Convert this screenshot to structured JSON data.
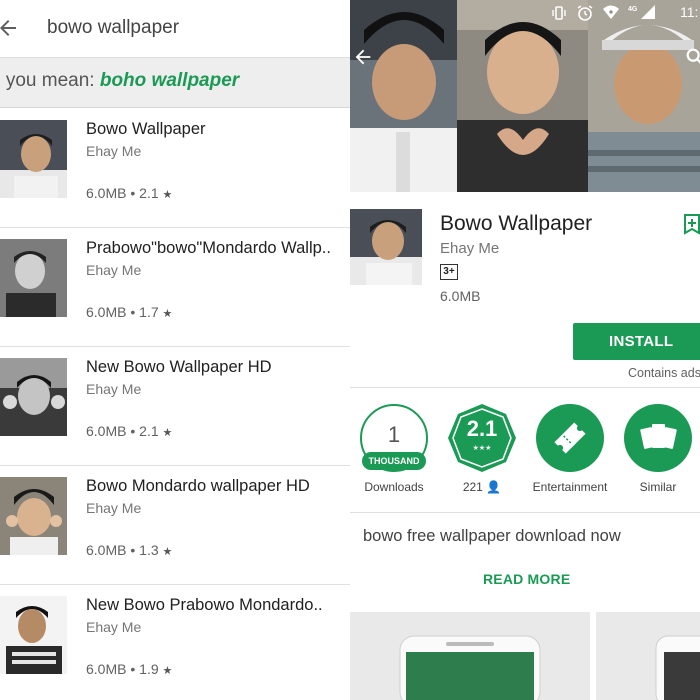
{
  "search": {
    "query": "bowo wallpaper",
    "did_you_mean_prefix": "d you mean: ",
    "did_you_mean_suggestion": "boho wallpaper"
  },
  "results": [
    {
      "title": "Bowo Wallpaper",
      "developer": "Ehay Me",
      "size": "6.0MB",
      "rating": "2.1"
    },
    {
      "title": "Prabowo\"bowo\"Mondardo Wallp..",
      "developer": "Ehay Me",
      "size": "6.0MB",
      "rating": "1.7"
    },
    {
      "title": "New Bowo Wallpaper HD",
      "developer": "Ehay Me",
      "size": "6.0MB",
      "rating": "2.1"
    },
    {
      "title": "Bowo Mondardo wallpaper HD",
      "developer": "Ehay Me",
      "size": "6.0MB",
      "rating": "1.3"
    },
    {
      "title": "New Bowo Prabowo Mondardo..",
      "developer": "Ehay Me",
      "size": "6.0MB",
      "rating": "1.9"
    }
  ],
  "status_bar": {
    "network": "4G",
    "time": "11:"
  },
  "app": {
    "title": "Bowo Wallpaper",
    "developer": "Ehay Me",
    "content_rating": "3+",
    "size": "6.0MB",
    "install_label": "INSTALL",
    "contains_ads": "Contains ads"
  },
  "stats": {
    "downloads_number": "1",
    "downloads_badge": "THOUSAND",
    "downloads_label": "Downloads",
    "rating_value": "2.1",
    "rating_count": "221",
    "category_label": "Entertainment",
    "similar_label": "Similar"
  },
  "description": {
    "text": "bowo free wallpaper download now",
    "read_more": "READ MORE"
  },
  "colors": {
    "accent_green": "#1a9a54",
    "did_you_mean_bg": "#eeeeee"
  },
  "icons": [
    "back-arrow-icon",
    "star-icon",
    "person-icon",
    "wishlist-icon",
    "ticket-icon",
    "cards-icon",
    "search-icon",
    "vibrate-icon",
    "alarm-icon",
    "wifi-icon",
    "signal-icon"
  ]
}
